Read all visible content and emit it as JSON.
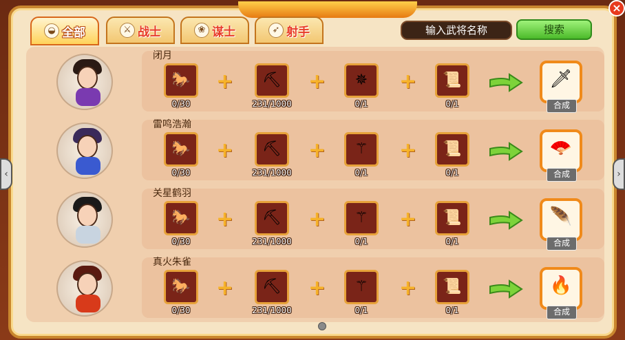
{
  "tabs": [
    {
      "label": "全部",
      "icon": "helmet-icon",
      "active": true
    },
    {
      "label": "战士",
      "icon": "sword-icon",
      "active": false
    },
    {
      "label": "谋士",
      "icon": "fan-icon",
      "active": false
    },
    {
      "label": "射手",
      "icon": "bow-icon",
      "active": false
    }
  ],
  "search": {
    "placeholder": "输入武将名称",
    "button_label": "搜索"
  },
  "close_label": "×",
  "recipes": [
    {
      "name": "闭月",
      "ingredients": [
        {
          "icon": "red-horse-icon",
          "count": "0/30"
        },
        {
          "icon": "iron-ore-icon",
          "count": "231/1000"
        },
        {
          "icon": "throwing-blade-icon",
          "count": "0/1"
        },
        {
          "icon": "golden-sword-scroll-icon",
          "count": "0/1"
        }
      ],
      "result_icon": "golden-sword-icon",
      "craft_label": "合成"
    },
    {
      "name": "雷鸣浩瀚",
      "ingredients": [
        {
          "icon": "red-horse-icon",
          "count": "0/30"
        },
        {
          "icon": "iron-ore-icon",
          "count": "231/1000"
        },
        {
          "icon": "staff-icon",
          "count": "0/1"
        },
        {
          "icon": "feather-fan-scroll-icon",
          "count": "0/1"
        }
      ],
      "result_icon": "feather-fan-icon",
      "craft_label": "合成"
    },
    {
      "name": "关星鹤羽",
      "ingredients": [
        {
          "icon": "red-horse-icon",
          "count": "0/30"
        },
        {
          "icon": "iron-ore-icon",
          "count": "231/1000"
        },
        {
          "icon": "staff-icon",
          "count": "0/1"
        },
        {
          "icon": "crane-fan-scroll-icon",
          "count": "0/1"
        }
      ],
      "result_icon": "crane-fan-icon",
      "craft_label": "合成"
    },
    {
      "name": "真火朱雀",
      "ingredients": [
        {
          "icon": "red-horse-icon",
          "count": "0/30"
        },
        {
          "icon": "iron-ore-icon",
          "count": "231/1000"
        },
        {
          "icon": "staff-icon",
          "count": "0/1"
        },
        {
          "icon": "phoenix-fan-scroll-icon",
          "count": "0/1"
        }
      ],
      "result_icon": "phoenix-fan-icon",
      "craft_label": "合成"
    }
  ]
}
